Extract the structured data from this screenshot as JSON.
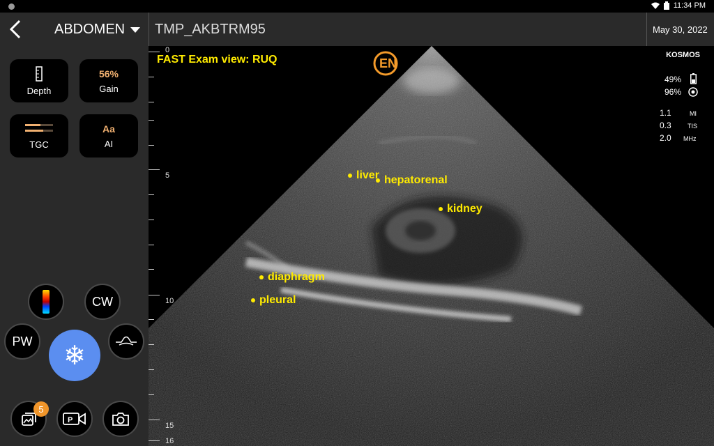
{
  "status": {
    "time": "11:34 PM"
  },
  "header": {
    "preset": "ABDOMEN",
    "patient_id": "TMP_AKBTRM95",
    "date": "May 30, 2022"
  },
  "controls": {
    "depth_label": "Depth",
    "gain_value": "56%",
    "gain_label": "Gain",
    "tgc_label": "TGC",
    "ai_icon_text": "Aa",
    "ai_label": "AI",
    "cw_label": "CW",
    "pw_label": "PW",
    "gallery_badge": "5"
  },
  "image": {
    "exam_title": "FAST Exam view: RUQ",
    "depth_labels": [
      "0",
      "5",
      "10",
      "15",
      "16"
    ],
    "annotations": {
      "liver": "liver",
      "hepatorenal": "hepatorenal",
      "kidney": "kidney",
      "diaphragm": "diaphragm",
      "pleural": "pleural"
    },
    "device": "KOSMOS",
    "battery_a": "49%",
    "battery_b": "96%",
    "mi_value": "1.1",
    "mi_label": "MI",
    "tis_value": "0.3",
    "tis_label": "TIS",
    "freq_value": "2.0",
    "freq_label": "MHz"
  },
  "colors": {
    "annotation": "#ffeb00",
    "freeze_button": "#5b8ef0",
    "badge": "#f0952a",
    "gain_accent": "#f0b070"
  }
}
